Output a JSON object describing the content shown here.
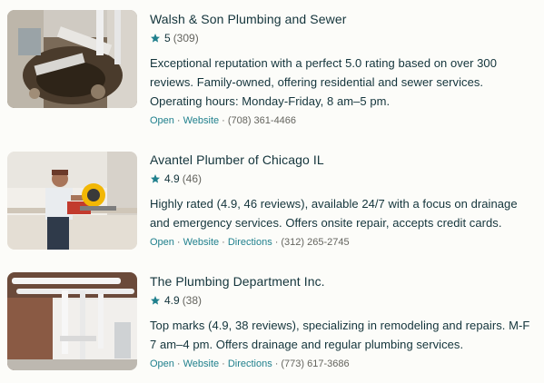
{
  "colors": {
    "accent": "#20808d",
    "text": "#13343b",
    "muted": "#64645e",
    "background": "#fcfcf9"
  },
  "results": [
    {
      "name": "Walsh & Son Plumbing and Sewer",
      "rating": "5",
      "reviews": "(309)",
      "description": "Exceptional reputation with a perfect 5.0 rating based on over 300 reviews. Family-owned, offering residential and sewer services. Operating hours: Monday-Friday, 8 am–5 pm.",
      "status": "Open",
      "website": "Website",
      "phone": "(708) 361-4466",
      "thumbnail_icon": "sewer-pipe-photo"
    },
    {
      "name": "Avantel Plumber of Chicago IL",
      "rating": "4.9",
      "reviews": "(46)",
      "description": "Highly rated (4.9, 46 reviews), available 24/7 with a focus on drainage and emergency services. Offers onsite repair, accepts credit cards.",
      "status": "Open",
      "website": "Website",
      "directions": "Directions",
      "phone": "(312) 265-2745",
      "thumbnail_icon": "worker-saw-photo"
    },
    {
      "name": "The Plumbing Department Inc.",
      "rating": "4.9",
      "reviews": "(38)",
      "description": "Top marks (4.9, 38 reviews), specializing in remodeling and repairs. M-F 7 am–4 pm. Offers drainage and regular plumbing services.",
      "status": "Open",
      "website": "Website",
      "directions": "Directions",
      "phone": "(773) 617-3686",
      "thumbnail_icon": "basement-pipes-photo"
    }
  ]
}
